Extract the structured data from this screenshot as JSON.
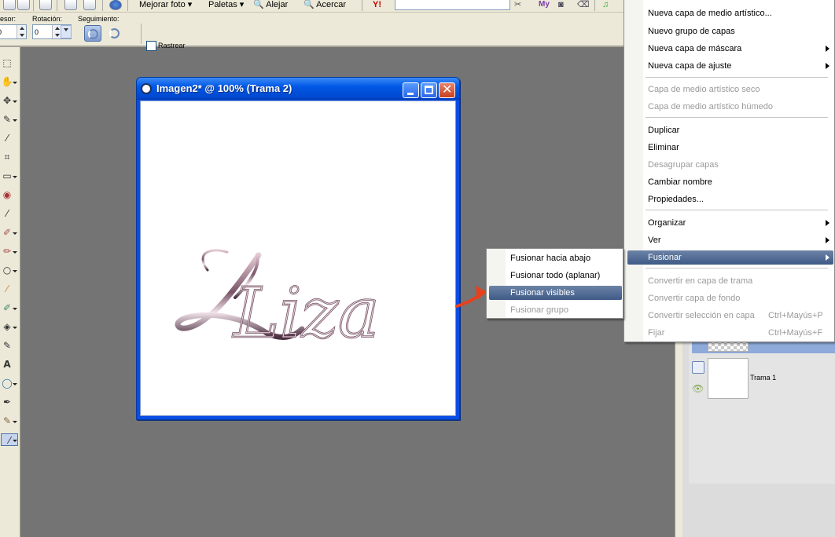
{
  "toolbar": {
    "mejorar_foto": "Mejorar foto",
    "paletas": "Paletas",
    "alejar": "Alejar",
    "acercar": "Acercar",
    "yahoo_badge": "Y!",
    "my_badge": "My"
  },
  "options": {
    "grosor_label": "esor:",
    "grosor_value": "0",
    "rotacion_label": "Rotación:",
    "rotacion_value": "0",
    "seguimiento_label": "Seguimiento:",
    "rastrear_label": "Rastrear"
  },
  "document": {
    "title": "Imagen2* @ 100% (Trama 2)",
    "canvas_text": "Liza",
    "canvas_color": "#ffffff",
    "title_gradient": "#0058e6"
  },
  "layers": {
    "layer1_name": "Trama 1"
  },
  "context_menu": {
    "items": [
      {
        "label": "Nueva capa de medio artístico...",
        "enabled": true,
        "submenu": false
      },
      {
        "label": "Nuevo grupo de capas",
        "enabled": true,
        "submenu": false
      },
      {
        "label": "Nueva capa de máscara",
        "enabled": true,
        "submenu": true
      },
      {
        "label": "Nueva capa de ajuste",
        "enabled": true,
        "submenu": true
      },
      {
        "label": "Capa de medio artístico seco",
        "enabled": false,
        "submenu": false
      },
      {
        "label": "Capa de medio artístico húmedo",
        "enabled": false,
        "submenu": false
      },
      {
        "label": "Duplicar",
        "enabled": true,
        "submenu": false
      },
      {
        "label": "Eliminar",
        "enabled": true,
        "submenu": false
      },
      {
        "label": "Desagrupar capas",
        "enabled": false,
        "submenu": false
      },
      {
        "label": "Cambiar nombre",
        "enabled": true,
        "submenu": false
      },
      {
        "label": "Propiedades...",
        "enabled": true,
        "submenu": false
      },
      {
        "label": "Organizar",
        "enabled": true,
        "submenu": true
      },
      {
        "label": "Ver",
        "enabled": true,
        "submenu": true
      },
      {
        "label": "Fusionar",
        "enabled": true,
        "submenu": true,
        "highlighted": true
      },
      {
        "label": "Convertir en capa de trama",
        "enabled": false,
        "submenu": false
      },
      {
        "label": "Convertir capa de fondo",
        "enabled": false,
        "submenu": false
      },
      {
        "label": "Convertir selección en capa",
        "enabled": false,
        "submenu": false,
        "shortcut": "Ctrl+Mayús+P"
      },
      {
        "label": "Fijar",
        "enabled": false,
        "submenu": false,
        "shortcut": "Ctrl+Mayús+F"
      }
    ],
    "highlight_color": "#4a6591"
  },
  "fusionar_submenu": {
    "items": [
      {
        "label": "Fusionar hacia abajo",
        "enabled": true
      },
      {
        "label": "Fusionar todo (aplanar)",
        "enabled": true
      },
      {
        "label": "Fusionar visibles",
        "enabled": true,
        "highlighted": true
      },
      {
        "label": "Fusionar grupo",
        "enabled": false
      }
    ]
  },
  "annotation": {
    "arrow_color": "#e8401c"
  }
}
